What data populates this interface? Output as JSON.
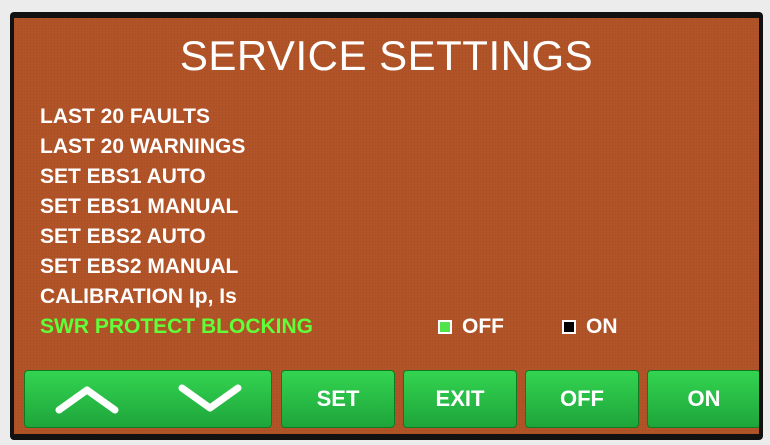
{
  "title": "SERVICE SETTINGS",
  "menu": [
    {
      "label": "LAST 20 FAULTS",
      "active": false
    },
    {
      "label": "LAST 20 WARNINGS",
      "active": false
    },
    {
      "label": "SET EBS1 AUTO",
      "active": false
    },
    {
      "label": "SET EBS1 MANUAL",
      "active": false
    },
    {
      "label": "SET EBS2 AUTO",
      "active": false
    },
    {
      "label": "SET EBS2 MANUAL",
      "active": false
    },
    {
      "label": "CALIBRATION Ip, Is",
      "active": false
    },
    {
      "label": "SWR PROTECT BLOCKING",
      "active": true
    }
  ],
  "status": {
    "off_label": "OFF",
    "off_selected": true,
    "on_label": "ON",
    "on_selected": false
  },
  "buttons": {
    "up_icon": "chevron-up-icon",
    "down_icon": "chevron-down-icon",
    "set_label": "SET",
    "exit_label": "EXIT",
    "off_label": "OFF",
    "on_label": "ON"
  },
  "colors": {
    "screen_background": "#b35428",
    "active_item": "#5fff3a",
    "button_green": "#2bc048",
    "indicator_off": "#4ee44a",
    "indicator_on": "#000000"
  }
}
